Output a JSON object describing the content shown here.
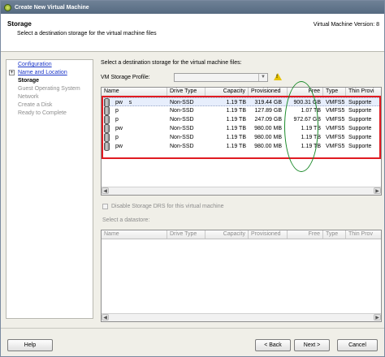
{
  "window": {
    "title": "Create New Virtual Machine",
    "page_title": "Storage",
    "page_subtitle": "Select a destination storage for the virtual machine files",
    "version_text": "Virtual Machine Version: 8"
  },
  "nav": {
    "items": [
      {
        "label": "Configuration",
        "state": "link"
      },
      {
        "label": "Name and Location",
        "state": "link"
      },
      {
        "label": "Storage",
        "state": "current"
      },
      {
        "label": "Guest Operating System",
        "state": "disabled"
      },
      {
        "label": "Network",
        "state": "disabled"
      },
      {
        "label": "Create a Disk",
        "state": "disabled"
      },
      {
        "label": "Ready to Complete",
        "state": "disabled"
      }
    ]
  },
  "storage": {
    "instruction": "Select a destination storage for the virtual machine files:",
    "profile_label": "VM Storage Profile:",
    "profile_value": "",
    "warning_icon": "warning-icon",
    "columns": [
      "Name",
      "Drive Type",
      "Capacity",
      "Provisioned",
      "Free",
      "Type",
      "Thin Provi"
    ],
    "rows": [
      {
        "name": "pw    s     ",
        "drive_type": "Non-SSD",
        "capacity": "1.19 TB",
        "provisioned": "319.44 GB",
        "free": "900.31 GB",
        "type": "VMFS5",
        "thin": "Supporte"
      },
      {
        "name": "p      ",
        "drive_type": "Non-SSD",
        "capacity": "1.19 TB",
        "provisioned": "127.89 GB",
        "free": "1.07 TB",
        "type": "VMFS5",
        "thin": "Supporte"
      },
      {
        "name": "p      ",
        "drive_type": "Non-SSD",
        "capacity": "1.19 TB",
        "provisioned": "247.09 GB",
        "free": "972.67 GB",
        "type": "VMFS5",
        "thin": "Supporte"
      },
      {
        "name": "pw     ",
        "drive_type": "Non-SSD",
        "capacity": "1.19 TB",
        "provisioned": "980.00 MB",
        "free": "1.19 TB",
        "type": "VMFS5",
        "thin": "Supporte"
      },
      {
        "name": "p      ",
        "drive_type": "Non-SSD",
        "capacity": "1.19 TB",
        "provisioned": "980.00 MB",
        "free": "1.19 TB",
        "type": "VMFS5",
        "thin": "Supporte"
      },
      {
        "name": "pw     ",
        "drive_type": "Non-SSD",
        "capacity": "1.19 TB",
        "provisioned": "980.00 MB",
        "free": "1.19 TB",
        "type": "VMFS5",
        "thin": "Supporte"
      }
    ],
    "disable_drs_label": "Disable Storage DRS for this virtual machine",
    "select_datastore_label": "Select a datastore:",
    "datastore_columns": [
      "Name",
      "Drive Type",
      "Capacity",
      "Provisioned",
      "Free",
      "Type",
      "Thin Prov"
    ]
  },
  "buttons": {
    "help": "Help",
    "back": "< Back",
    "next": "Next >",
    "cancel": "Cancel"
  },
  "annotations": {
    "highlight_color": "#e01b22",
    "oval_color": "#1b8a2a"
  }
}
